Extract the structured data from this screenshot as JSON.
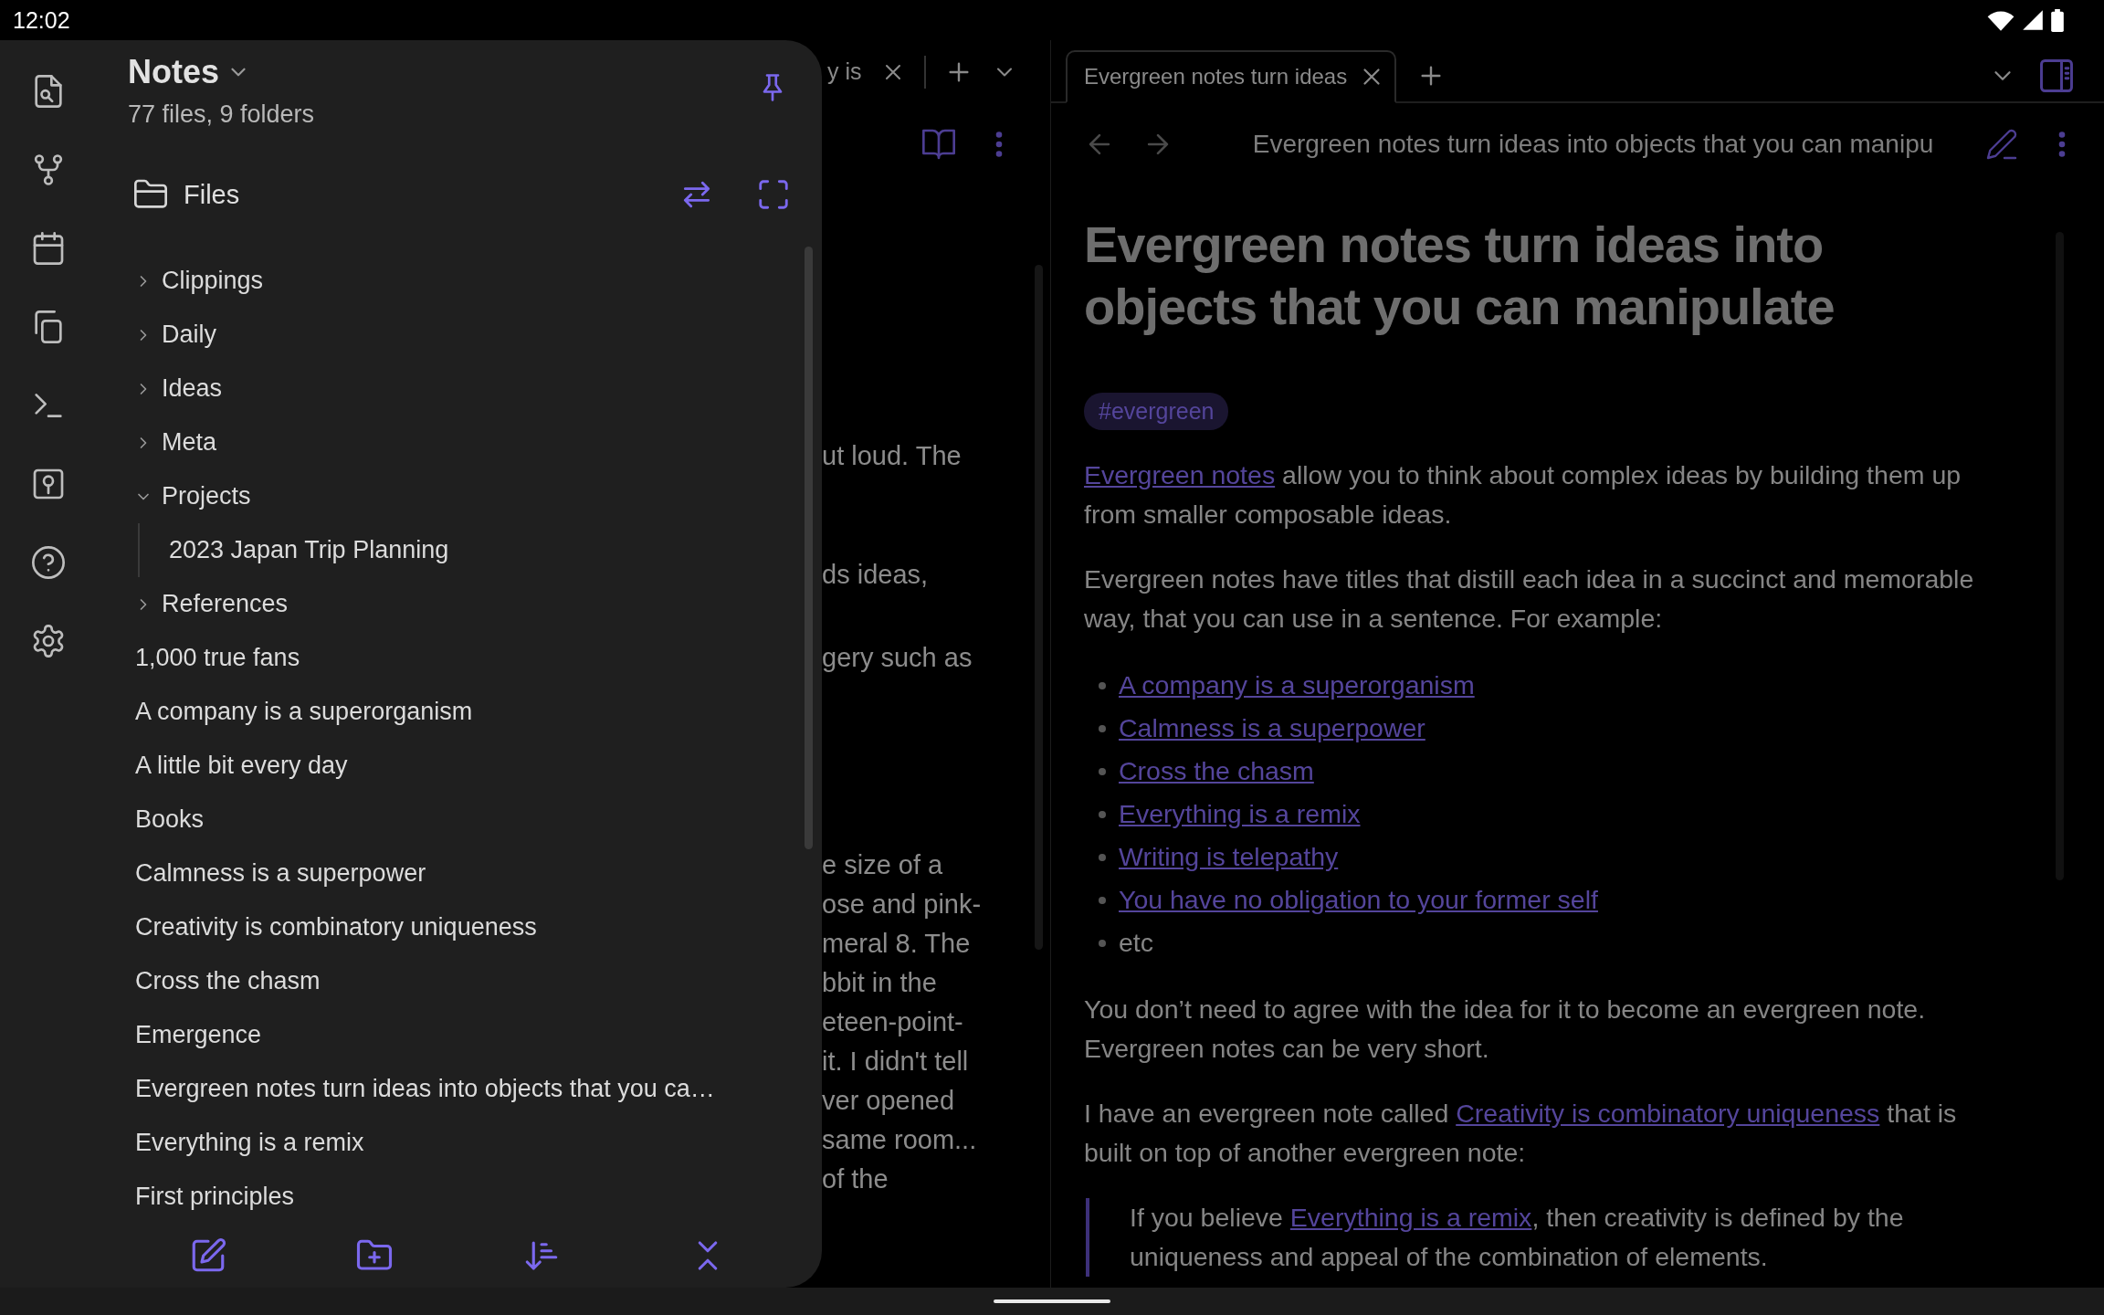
{
  "status_bar": {
    "time": "12:02"
  },
  "sidebar": {
    "title": "Notes",
    "subtitle": "77 files, 9 folders",
    "section": "Files",
    "tree": [
      {
        "label": "Clippings",
        "kind": "folder",
        "expanded": false
      },
      {
        "label": "Daily",
        "kind": "folder",
        "expanded": false
      },
      {
        "label": "Ideas",
        "kind": "folder",
        "expanded": false
      },
      {
        "label": "Meta",
        "kind": "folder",
        "expanded": false
      },
      {
        "label": "Projects",
        "kind": "folder",
        "expanded": true,
        "children": [
          {
            "label": "2023 Japan Trip Planning",
            "kind": "file"
          }
        ]
      },
      {
        "label": "References",
        "kind": "folder",
        "expanded": false
      },
      {
        "label": "1,000 true fans",
        "kind": "file"
      },
      {
        "label": "A company is a superorganism",
        "kind": "file"
      },
      {
        "label": "A little bit every day",
        "kind": "file"
      },
      {
        "label": "Books",
        "kind": "file"
      },
      {
        "label": "Calmness is a superpower",
        "kind": "file"
      },
      {
        "label": "Creativity is combinatory uniqueness",
        "kind": "file"
      },
      {
        "label": "Cross the chasm",
        "kind": "file"
      },
      {
        "label": "Emergence",
        "kind": "file"
      },
      {
        "label": "Evergreen notes turn ideas into objects that you ca…",
        "kind": "file"
      },
      {
        "label": "Everything is a remix",
        "kind": "file"
      },
      {
        "label": "First principles",
        "kind": "file"
      }
    ]
  },
  "left_pane": {
    "tab_title": "y is",
    "text_fragments": [
      "ut loud. The",
      "ds ideas,",
      "gery such as",
      "e size of a",
      "ose and pink-",
      "meral 8. The",
      "bbit in the",
      "eteen-point-",
      "it. I didn't tell",
      "ver opened",
      "same room...",
      "of the"
    ]
  },
  "right_pane": {
    "tabs": [
      {
        "title": "Evergreen notes turn ideas",
        "selected": true
      }
    ],
    "breadcrumb": "Evergreen notes turn ideas into objects that you can manipu",
    "heading": "Evergreen notes turn ideas into objects that you can manipulate",
    "tag": "#evergreen",
    "blocks": [
      {
        "kind": "paragraph",
        "parts": [
          {
            "text": "Evergreen notes",
            "link": true
          },
          {
            "text": " allow you to think about complex ideas by building them up from smaller composable ideas."
          }
        ]
      },
      {
        "kind": "paragraph",
        "parts": [
          {
            "text": "Evergreen notes have titles that distill each idea in a succinct and memorable way, that you can use in a sentence. For example:"
          }
        ]
      },
      {
        "kind": "list",
        "items": [
          {
            "text": "A company is a superorganism",
            "link": true
          },
          {
            "text": "Calmness is a superpower",
            "link": true
          },
          {
            "text": "Cross the chasm",
            "link": true
          },
          {
            "text": "Everything is a remix",
            "link": true
          },
          {
            "text": "Writing is telepathy",
            "link": true
          },
          {
            "text": "You have no obligation to your former self",
            "link": true
          },
          {
            "text": "etc"
          }
        ]
      },
      {
        "kind": "paragraph",
        "parts": [
          {
            "text": "You don’t need to agree with the idea for it to become an evergreen note. Evergreen notes can be very short."
          }
        ]
      },
      {
        "kind": "paragraph",
        "parts": [
          {
            "text": "I have an evergreen note called "
          },
          {
            "text": "Creativity is combinatory uniqueness",
            "link": true
          },
          {
            "text": " that is built on top of another evergreen note:"
          }
        ]
      },
      {
        "kind": "quote",
        "parts": [
          {
            "text": "If you believe "
          },
          {
            "text": "Everything is a remix",
            "link": true
          },
          {
            "text": ", then creativity is defined by the uniqueness and appeal of the combination of elements."
          }
        ]
      }
    ]
  }
}
